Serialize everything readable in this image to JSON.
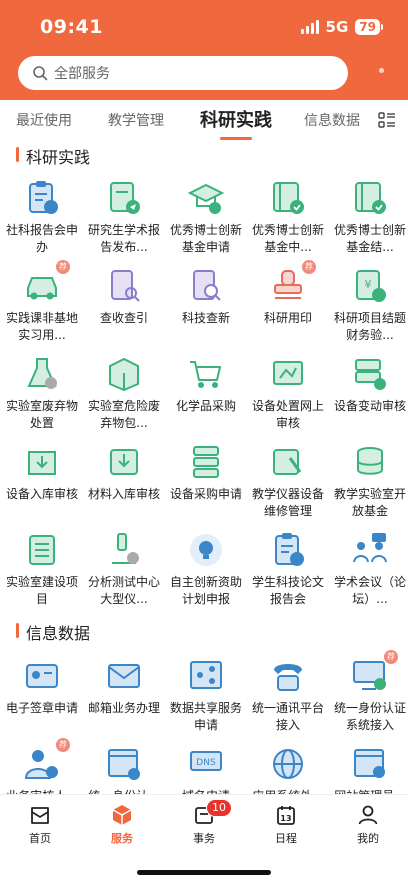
{
  "status": {
    "time": "09:41",
    "network": "5G",
    "battery": "79"
  },
  "search": {
    "placeholder": "全部服务"
  },
  "tabs": [
    {
      "label": "最近使用"
    },
    {
      "label": "教学管理"
    },
    {
      "label": "科研实践"
    },
    {
      "label": "信息数据"
    }
  ],
  "active_tab": "科研实践",
  "sections": {
    "research": {
      "title": "科研实践",
      "items": [
        {
          "label": "社科报告会申办",
          "icon": "clipboard-icon"
        },
        {
          "label": "研究生学术报告发布...",
          "icon": "doc-send-icon"
        },
        {
          "label": "优秀博士创新基金申请",
          "icon": "graduation-cap-icon"
        },
        {
          "label": "优秀博士创新基金中...",
          "icon": "book-check-icon"
        },
        {
          "label": "优秀博士创新基金结...",
          "icon": "book-check-icon"
        },
        {
          "label": "实践课非基地实习用...",
          "icon": "car-icon",
          "badge": "荐"
        },
        {
          "label": "查收查引",
          "icon": "doc-search-icon"
        },
        {
          "label": "科技查新",
          "icon": "doc-magnifier-icon"
        },
        {
          "label": "科研用印",
          "icon": "stamp-icon",
          "badge": "荐"
        },
        {
          "label": "科研项目结题财务验...",
          "icon": "ledger-check-icon"
        },
        {
          "label": "实验室废弃物处置",
          "icon": "flask-x-icon"
        },
        {
          "label": "实验室危险废弃物包...",
          "icon": "box-icon"
        },
        {
          "label": "化学品采购",
          "icon": "cart-icon"
        },
        {
          "label": "设备处置网上审核",
          "icon": "equipment-icon"
        },
        {
          "label": "设备变动审核",
          "icon": "server-refresh-icon"
        },
        {
          "label": "设备入库审核",
          "icon": "inbox-icon"
        },
        {
          "label": "材料入库审核",
          "icon": "download-tray-icon"
        },
        {
          "label": "设备采购申请",
          "icon": "server-icon"
        },
        {
          "label": "教学仪器设备维修管理",
          "icon": "wrench-icon"
        },
        {
          "label": "教学实验室开放基金",
          "icon": "coins-icon"
        },
        {
          "label": "实验室建设项目",
          "icon": "layers-icon"
        },
        {
          "label": "分析测试中心大型仪...",
          "icon": "microscope-icon"
        },
        {
          "label": "自主创新资助计划申报",
          "icon": "lightbulb-icon"
        },
        {
          "label": "学生科技论文报告会",
          "icon": "clipboard-icon"
        },
        {
          "label": "学术会议（论坛）...",
          "icon": "meeting-icon"
        }
      ]
    },
    "info": {
      "title": "信息数据",
      "items": [
        {
          "label": "电子签章申请",
          "icon": "id-card-icon"
        },
        {
          "label": "邮箱业务办理",
          "icon": "mail-icon"
        },
        {
          "label": "数据共享服务申请",
          "icon": "share-icon"
        },
        {
          "label": "统一通讯平台接入",
          "icon": "phone-icon"
        },
        {
          "label": "统一身份认证系统接入",
          "icon": "monitor-user-icon",
          "badge": "荐"
        },
        {
          "label": "业务审核人...",
          "icon": "user-shield-icon",
          "badge": "荐"
        },
        {
          "label": "统一身份认...",
          "icon": "window-add-icon"
        },
        {
          "label": "域名申请",
          "icon": "dns-icon"
        },
        {
          "label": "应用系统外...",
          "icon": "globe-icon"
        },
        {
          "label": "网站管理员...",
          "icon": "web-admin-icon"
        }
      ]
    }
  },
  "bottom_nav": [
    {
      "label": "首页",
      "icon": "home-icon"
    },
    {
      "label": "服务",
      "icon": "cube-icon"
    },
    {
      "label": "事务",
      "icon": "inbox-tray-icon",
      "badge": "10"
    },
    {
      "label": "日程",
      "icon": "calendar-icon",
      "day": "13"
    },
    {
      "label": "我的",
      "icon": "person-icon"
    }
  ],
  "colors": {
    "accent": "#f0683e",
    "icon_blue": "#3a86c8",
    "icon_green": "#3bb27b",
    "icon_red": "#e86a5a"
  }
}
